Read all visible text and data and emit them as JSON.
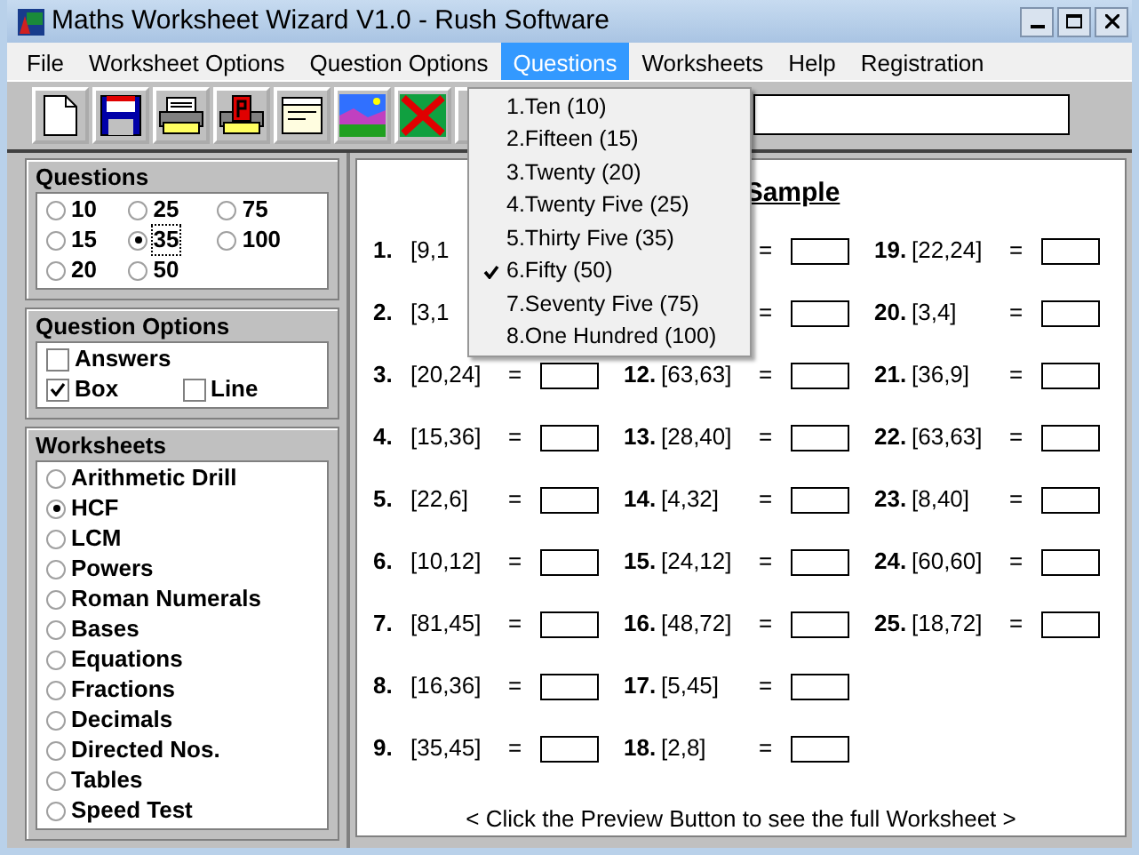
{
  "window": {
    "title": "Maths Worksheet Wizard V1.0 - Rush Software"
  },
  "menu": [
    {
      "label": "File",
      "selected": false
    },
    {
      "label": "Worksheet Options",
      "selected": false
    },
    {
      "label": "Question Options",
      "selected": false
    },
    {
      "label": "Questions",
      "selected": true
    },
    {
      "label": "Worksheets",
      "selected": false
    },
    {
      "label": "Help",
      "selected": false
    },
    {
      "label": "Registration",
      "selected": false
    }
  ],
  "questions_menu": [
    {
      "label": "1.Ten (10)",
      "checked": false
    },
    {
      "label": "2.Fifteen (15)",
      "checked": false
    },
    {
      "label": "3.Twenty (20)",
      "checked": false
    },
    {
      "label": "4.Twenty Five (25)",
      "checked": false
    },
    {
      "label": "5.Thirty Five (35)",
      "checked": false
    },
    {
      "label": "6.Fifty (50)",
      "checked": true
    },
    {
      "label": "7.Seventy Five (75)",
      "checked": false
    },
    {
      "label": "8.One Hundred (100)",
      "checked": false
    }
  ],
  "toolbar": [
    {
      "kind": "new"
    },
    {
      "kind": "save"
    },
    {
      "kind": "print"
    },
    {
      "kind": "preview"
    },
    {
      "kind": "window"
    },
    {
      "kind": "image"
    },
    {
      "kind": "delete"
    },
    {
      "kind": "hidden"
    }
  ],
  "questions": {
    "title": "Questions",
    "columns": [
      [
        {
          "label": "10",
          "selected": false
        },
        {
          "label": "15",
          "selected": false
        },
        {
          "label": "20",
          "selected": false
        }
      ],
      [
        {
          "label": "25",
          "selected": false
        },
        {
          "label": "35",
          "selected": true
        },
        {
          "label": "50",
          "selected": false
        }
      ],
      [
        {
          "label": "75",
          "selected": false
        },
        {
          "label": "100",
          "selected": false
        }
      ]
    ]
  },
  "question_options": {
    "title": "Question Options",
    "rows": [
      [
        {
          "label": "Answers",
          "kind": "answers",
          "checked": false
        }
      ],
      [
        {
          "label": "Box",
          "kind": "box",
          "checked": true
        },
        {
          "label": "Line",
          "kind": "line",
          "checked": false
        }
      ]
    ]
  },
  "worksheets": {
    "title": "Worksheets",
    "options": [
      {
        "label": "Arithmetic Drill",
        "selected": false
      },
      {
        "label": "HCF",
        "selected": true
      },
      {
        "label": "LCM",
        "selected": false
      },
      {
        "label": "Powers",
        "selected": false
      },
      {
        "label": "Roman Numerals",
        "selected": false
      },
      {
        "label": "Bases",
        "selected": false
      },
      {
        "label": "Equations",
        "selected": false
      },
      {
        "label": "Fractions",
        "selected": false
      },
      {
        "label": "Decimals",
        "selected": false
      },
      {
        "label": "Directed Nos.",
        "selected": false
      },
      {
        "label": "Tables",
        "selected": false
      },
      {
        "label": "Speed Test",
        "selected": false
      }
    ]
  },
  "sheet": {
    "title": "Sample",
    "columns": [
      [
        {
          "num": "1.",
          "expr": "[9,1"
        },
        {
          "num": "2.",
          "expr": "[3,1"
        },
        {
          "num": "3.",
          "expr": "[20,24]",
          "eq": "="
        },
        {
          "num": "4.",
          "expr": "[15,36]",
          "eq": "="
        },
        {
          "num": "5.",
          "expr": "[22,6]",
          "eq": "="
        },
        {
          "num": "6.",
          "expr": "[10,12]",
          "eq": "="
        },
        {
          "num": "7.",
          "expr": "[81,45]",
          "eq": "="
        },
        {
          "num": "8.",
          "expr": "[16,36]",
          "eq": "="
        },
        {
          "num": "9.",
          "expr": "[35,45]",
          "eq": "="
        }
      ],
      [
        {
          "eq": "="
        },
        {
          "eq": "="
        },
        {
          "num": "12.",
          "expr": "[63,63]",
          "eq": "="
        },
        {
          "num": "13.",
          "expr": "[28,40]",
          "eq": "="
        },
        {
          "num": "14.",
          "expr": "[4,32]",
          "eq": "="
        },
        {
          "num": "15.",
          "expr": "[24,12]",
          "eq": "="
        },
        {
          "num": "16.",
          "expr": "[48,72]",
          "eq": "="
        },
        {
          "num": "17.",
          "expr": "[5,45]",
          "eq": "="
        },
        {
          "num": "18.",
          "expr": "[2,8]",
          "eq": "="
        }
      ],
      [
        {
          "num": "19.",
          "expr": "[22,24]",
          "eq": "="
        },
        {
          "num": "20.",
          "expr": "[3,4]",
          "eq": "="
        },
        {
          "num": "21.",
          "expr": "[36,9]",
          "eq": "="
        },
        {
          "num": "22.",
          "expr": "[63,63]",
          "eq": "="
        },
        {
          "num": "23.",
          "expr": "[8,40]",
          "eq": "="
        },
        {
          "num": "24.",
          "expr": "[60,60]",
          "eq": "="
        },
        {
          "num": "25.",
          "expr": "[18,72]",
          "eq": "="
        }
      ]
    ],
    "footer": "< Click the Preview Button to see the full Worksheet >"
  }
}
